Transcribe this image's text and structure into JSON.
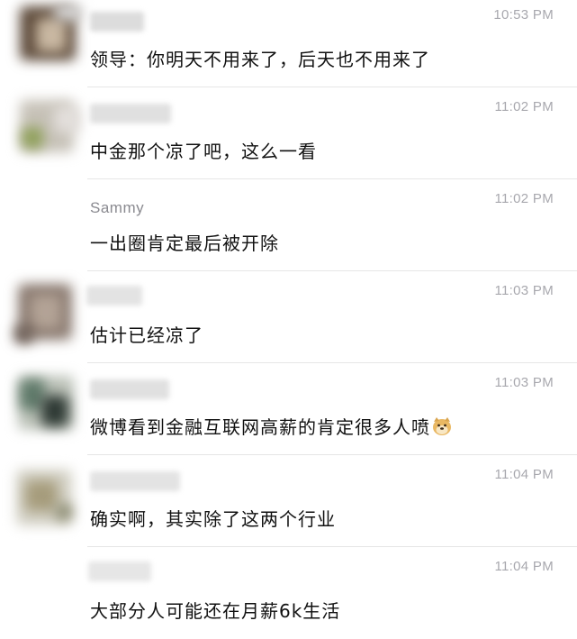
{
  "messages": [
    {
      "time": "10:53 PM",
      "text": "领导：你明天不用来了，后天也不用来了"
    },
    {
      "time": "11:02 PM",
      "text": "中金那个凉了吧，这么一看"
    },
    {
      "sender": "Sammy",
      "time": "11:02 PM",
      "text": "一出圈肯定最后被开除"
    },
    {
      "time": "11:03 PM",
      "text": "估计已经凉了"
    },
    {
      "time": "11:03 PM",
      "text": "微博看到金融互联网高薪的肯定很多人喷",
      "emoji": "doge-icon"
    },
    {
      "time": "11:04 PM",
      "text": "确实啊，其实除了这两个行业"
    },
    {
      "time": "11:04 PM",
      "text": "大部分人可能还在月薪6k生活"
    }
  ]
}
